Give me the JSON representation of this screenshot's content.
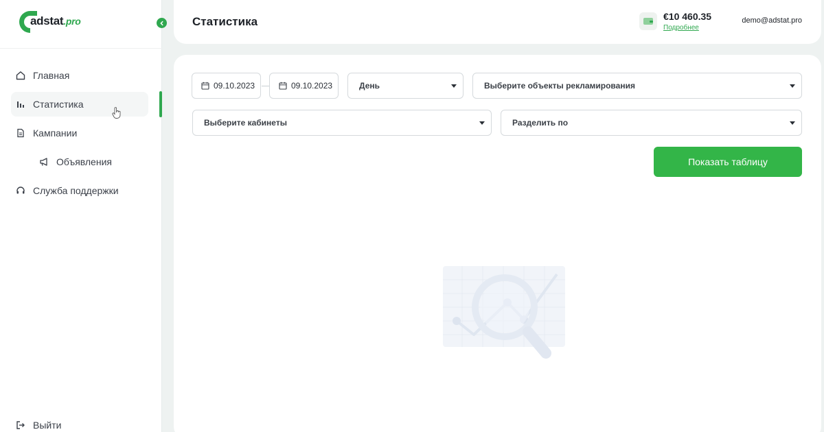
{
  "brand": {
    "logo_text": "adstat",
    "logo_suffix": ".pro",
    "accent": "#2fa84f"
  },
  "sidebar": {
    "items": [
      {
        "label": "Главная",
        "icon": "home-icon"
      },
      {
        "label": "Статистика",
        "icon": "bar-chart-icon",
        "active": true
      },
      {
        "label": "Кампании",
        "icon": "document-icon"
      },
      {
        "label": "Объявления",
        "icon": "megaphone-icon",
        "sub": true
      },
      {
        "label": "Служба поддержки",
        "icon": "headset-icon"
      }
    ],
    "logout_label": "Выйти"
  },
  "header": {
    "title": "Статистика",
    "balance": "€10 460.35",
    "details_link": "Подробнее",
    "user_email": "demo@adstat.pro"
  },
  "filters": {
    "date_from": "09.10.2023",
    "date_to": "09.10.2023",
    "granularity": "День",
    "ad_objects_placeholder": "Выберите объекты рекламирования",
    "accounts_placeholder": "Выберите кабинеты",
    "split_by_placeholder": "Разделить по"
  },
  "actions": {
    "show_table_label": "Показать таблицу"
  }
}
